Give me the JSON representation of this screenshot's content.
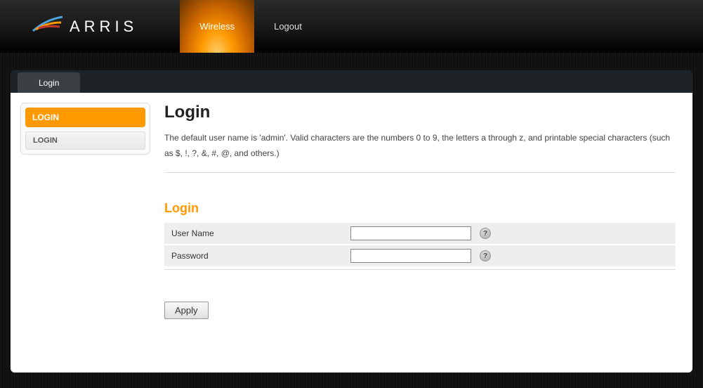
{
  "brand": "ARRIS",
  "top_nav": {
    "wireless": "Wireless",
    "logout": "Logout"
  },
  "tab": {
    "login": "Login"
  },
  "sidebar": {
    "header": "LOGIN",
    "items": [
      "LOGIN"
    ]
  },
  "page": {
    "title": "Login",
    "description": "The default user name is 'admin'. Valid characters are the numbers 0 to 9, the letters a through z, and printable special characters (such as $, !, ?, &, #, @, and others.)"
  },
  "form": {
    "section_title": "Login",
    "username_label": "User Name",
    "username_value": "",
    "password_label": "Password",
    "password_value": "",
    "apply_label": "Apply"
  },
  "icons": {
    "help": "?"
  }
}
